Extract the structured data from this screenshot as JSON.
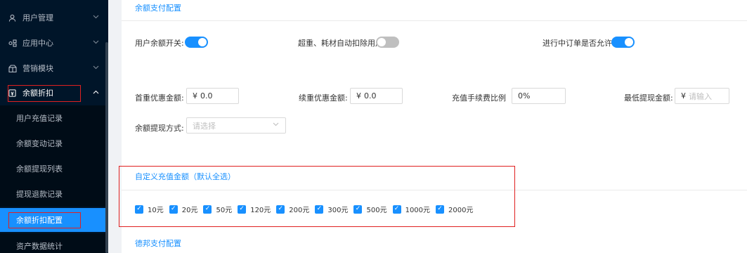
{
  "sidebar": {
    "menu": [
      {
        "label": "用户管理",
        "icon": "user-icon"
      },
      {
        "label": "应用中心",
        "icon": "apps-icon"
      },
      {
        "label": "营销模块",
        "icon": "gift-icon"
      },
      {
        "label": "余额折扣",
        "icon": "wallet-icon"
      }
    ],
    "submenu": [
      {
        "label": "用户充值记录"
      },
      {
        "label": "余额变动记录"
      },
      {
        "label": "余额提现列表"
      },
      {
        "label": "提现退款记录"
      },
      {
        "label": "余额折扣配置"
      },
      {
        "label": "资产数据统计"
      }
    ]
  },
  "main": {
    "section1_title": "余额支付配置",
    "switches": [
      {
        "label": "用户余额开关:",
        "on": true
      },
      {
        "label": "超重、耗材自动扣除用户",
        "on": false
      },
      {
        "label": "进行中订单是否允许",
        "on": true
      }
    ],
    "fields": {
      "first_discount": {
        "label": "首重优惠金额:",
        "prefix": "¥",
        "value": "0.0"
      },
      "renew_discount": {
        "label": "续重优惠金额:",
        "prefix": "¥",
        "value": "0.0"
      },
      "fee_ratio": {
        "label": "充值手续费比例",
        "value": "0%"
      },
      "min_withdraw": {
        "label": "最低提现金额:",
        "prefix": "¥",
        "placeholder": "请输入"
      },
      "withdraw_method": {
        "label": "余额提现方式:",
        "placeholder": "请选择"
      }
    },
    "section2_title": "自定义充值金额（默认全选）",
    "amounts": [
      "10元",
      "20元",
      "50元",
      "120元",
      "200元",
      "300元",
      "500元",
      "1000元",
      "2000元"
    ],
    "section3_title": "德邦支付配置"
  },
  "colors": {
    "accent": "#1890ff",
    "sidebar_bg": "#001529",
    "highlight_box": "#e02020"
  }
}
